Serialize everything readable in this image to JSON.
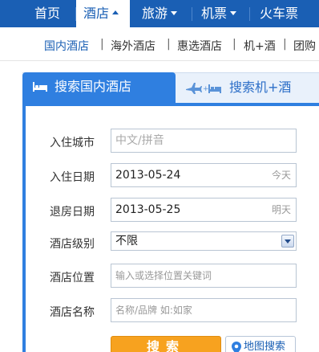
{
  "topnav": {
    "items": [
      {
        "label": "首页"
      },
      {
        "label": "酒店"
      },
      {
        "label": "旅游"
      },
      {
        "label": "机票"
      },
      {
        "label": "火车票"
      }
    ]
  },
  "subnav": {
    "items": [
      {
        "label": "国内酒店"
      },
      {
        "label": "海外酒店"
      },
      {
        "label": "惠选酒店"
      },
      {
        "label": "机+酒"
      },
      {
        "label": "团购"
      }
    ],
    "separator": "|"
  },
  "tabs": {
    "active": {
      "label": "搜索国内酒店",
      "icon": "bed-icon"
    },
    "inactive": {
      "label": "搜索机+酒",
      "icon": "plane-bed-icon"
    }
  },
  "form": {
    "city": {
      "label": "入住城市",
      "placeholder": "中文/拼音"
    },
    "checkin": {
      "label": "入住日期",
      "value": "2013-05-24",
      "hint": "今天"
    },
    "checkout": {
      "label": "退房日期",
      "value": "2013-05-25",
      "hint": "明天"
    },
    "star": {
      "label": "酒店级别",
      "value": "不限"
    },
    "location": {
      "label": "酒店位置",
      "placeholder": "输入或选择位置关键词"
    },
    "name": {
      "label": "酒店名称",
      "placeholder": "名称/品牌 如:如家"
    }
  },
  "buttons": {
    "search": "搜索",
    "map": "地图搜索"
  },
  "colors": {
    "brand_blue": "#1a5fb4",
    "tab_blue": "#2f7fe0",
    "search_orange": "#f7a21f"
  }
}
